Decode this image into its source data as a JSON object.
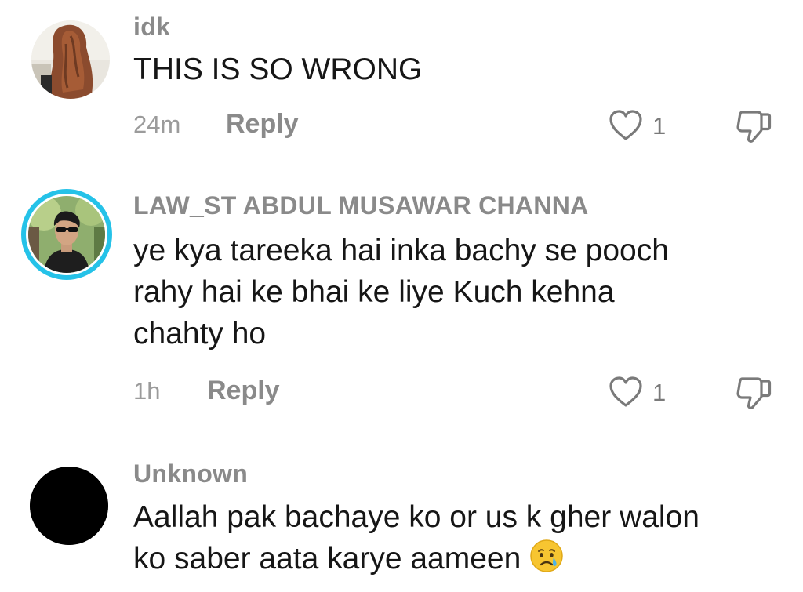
{
  "comments": [
    {
      "username": "idk",
      "text_lines": [
        "THIS IS SO WRONG"
      ],
      "time": "24m",
      "reply_label": "Reply",
      "likes": "1",
      "avatar_icon": "avatar-woman-long-hair",
      "has_story_ring": false
    },
    {
      "username": "LAW_ST ABDUL MUSAWAR CHANNA",
      "text_lines": [
        "ye kya tareeka hai inka bachy se pooch",
        "rahy hai ke bhai ke liye Kuch kehna",
        "chahty ho"
      ],
      "time": "1h",
      "reply_label": "Reply",
      "likes": "1",
      "avatar_icon": "avatar-man-sunglasses",
      "has_story_ring": true,
      "ring_color": "#25c2e8"
    },
    {
      "username": "Unknown",
      "text_lines": [
        "Aallah pak bachaye ko or us k gher walon",
        "ko saber aata karye aameen"
      ],
      "trailing_emoji": "crying-face-emoji",
      "avatar_icon": "avatar-black"
    }
  ],
  "colors": {
    "username": "#8a8a8a",
    "text": "#161616",
    "meta": "#9b9b9b",
    "story_ring": "#25c2e8"
  }
}
